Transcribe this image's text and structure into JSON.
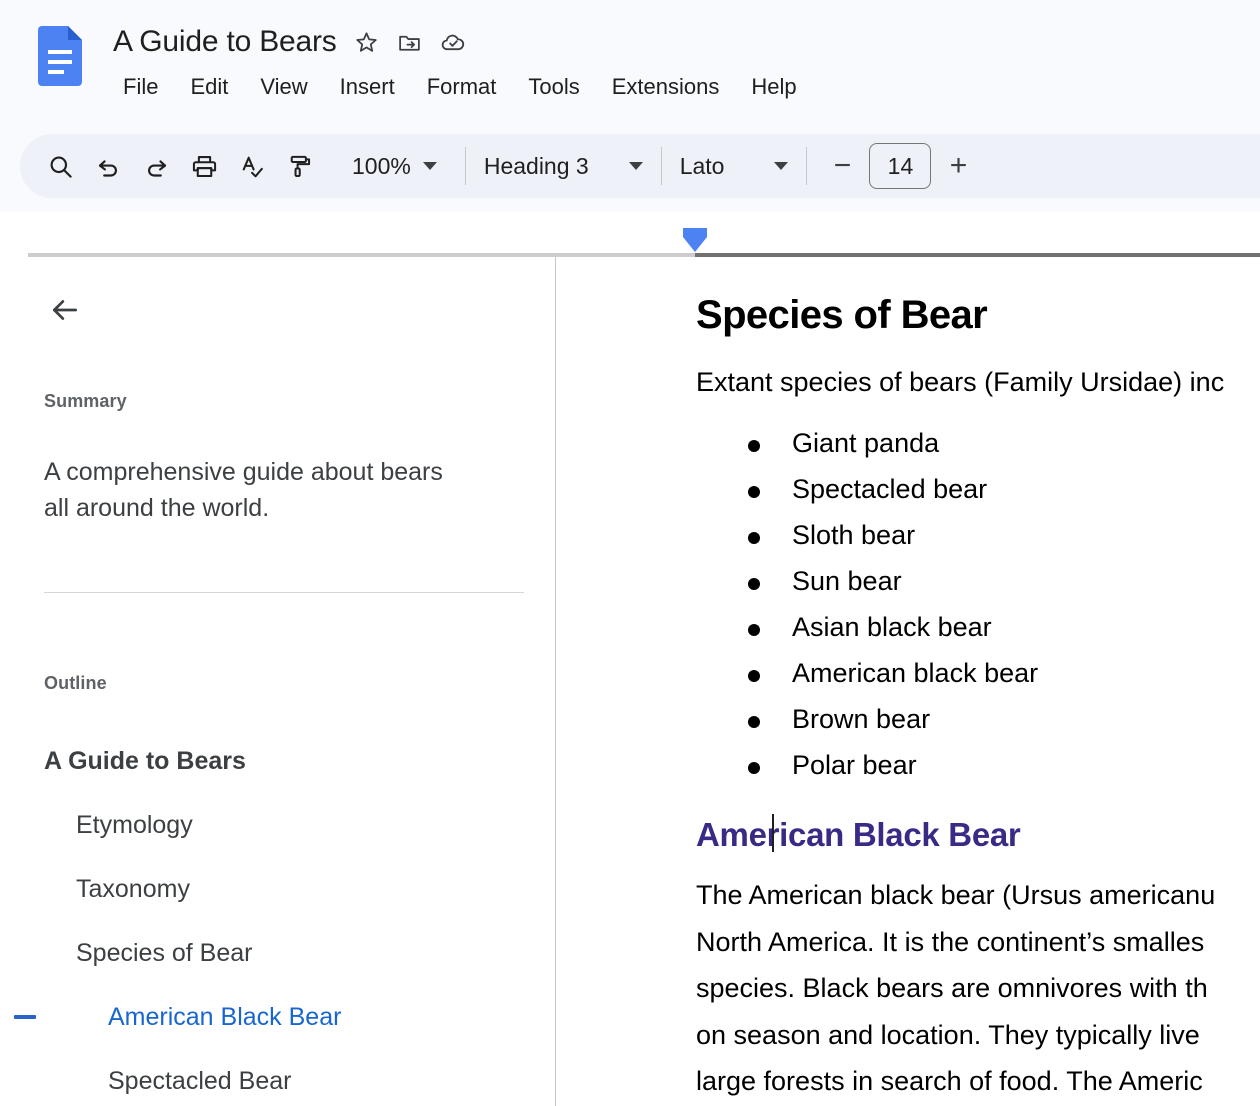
{
  "app": {
    "logo_icon": "google-docs-icon"
  },
  "header": {
    "doc_title": "A Guide to Bears",
    "star_icon": "star-icon",
    "move_folder_icon": "move-to-folder-icon",
    "cloud_saved_icon": "cloud-saved-icon",
    "menus": [
      {
        "label": "File"
      },
      {
        "label": "Edit"
      },
      {
        "label": "View"
      },
      {
        "label": "Insert"
      },
      {
        "label": "Format"
      },
      {
        "label": "Tools"
      },
      {
        "label": "Extensions"
      },
      {
        "label": "Help"
      }
    ]
  },
  "toolbar": {
    "search_icon": "search-icon",
    "undo_icon": "undo-icon",
    "redo_icon": "redo-icon",
    "print_icon": "print-icon",
    "spellcheck_icon": "spellcheck-icon",
    "paint_format_icon": "paint-format-icon",
    "zoom_level": "100%",
    "paragraph_style": "Heading 3",
    "font_family": "Lato",
    "font_size": "14",
    "decrease_font_label": "−",
    "increase_font_label": "+"
  },
  "ruler": {
    "indent_marker_icon": "indent-marker-icon"
  },
  "sidebar": {
    "back_icon": "back-arrow-icon",
    "summary_label": "Summary",
    "summary_text": "A comprehensive guide about bears all around the world.",
    "outline_label": "Outline",
    "outline_items": [
      {
        "label": "A Guide to Bears",
        "level": 0,
        "active": false,
        "collapsible": false
      },
      {
        "label": "Etymology",
        "level": 1,
        "active": false,
        "collapsible": false
      },
      {
        "label": "Taxonomy",
        "level": 1,
        "active": false,
        "collapsible": false
      },
      {
        "label": "Species of Bear",
        "level": 1,
        "active": false,
        "collapsible": false
      },
      {
        "label": "American Black Bear",
        "level": 2,
        "active": true,
        "collapsible": true
      },
      {
        "label": "Spectacled Bear",
        "level": 2,
        "active": false,
        "collapsible": false
      }
    ]
  },
  "document": {
    "section_heading": "Species of Bear",
    "intro_paragraph": "Extant species of bears (Family Ursidae) inc",
    "species_list": [
      "Giant panda",
      "Spectacled bear",
      "Sloth bear",
      "Sun bear",
      "Asian black bear",
      "American black bear",
      "Brown bear",
      "Polar bear"
    ],
    "subsection_heading": "American Black Bear",
    "body_lines": [
      "The American black bear (Ursus americanu",
      "North America. It is the continent’s smalles",
      "species. Black bears are omnivores with th",
      "on season and location. They typically live",
      "large forests in search of food. The Americ"
    ]
  },
  "colors": {
    "docs_blue": "#4285f4",
    "link_blue": "#1a66d0",
    "heading_purple": "#3b2a85",
    "toolbar_bg": "#eef1f8",
    "header_bg": "#f9fafd"
  }
}
